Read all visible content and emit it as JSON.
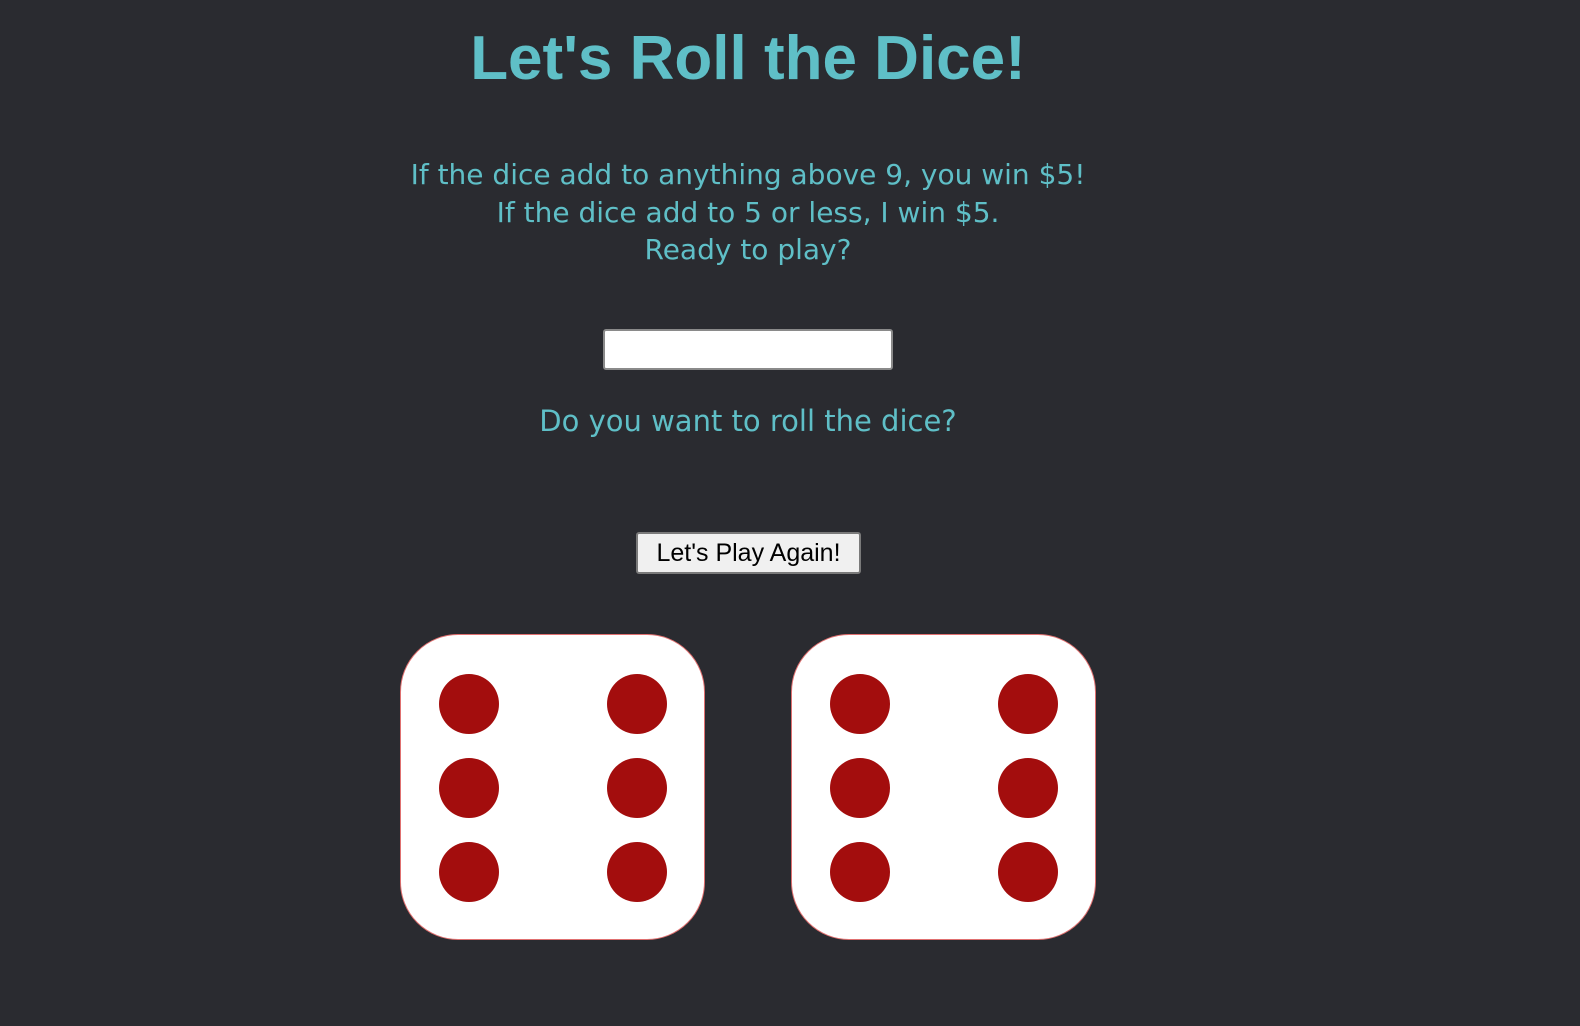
{
  "header": {
    "title": "Let's Roll the Dice!"
  },
  "rules": {
    "line1": "If the dice add to anything above 9, you win $5!",
    "line2": "If the dice add to 5 or less, I win $5.",
    "line3": "Ready to play?"
  },
  "name_input": {
    "value": ""
  },
  "question": "Do you want to roll the dice?",
  "play_again_button": {
    "label": "Let's Play Again!"
  },
  "dice": [
    {
      "value": 6
    },
    {
      "value": 6
    }
  ],
  "colors": {
    "background": "#2a2b30",
    "accent_text": "#5fbfc7",
    "die_face": "#ffffff",
    "pip": "#a30d0d"
  }
}
